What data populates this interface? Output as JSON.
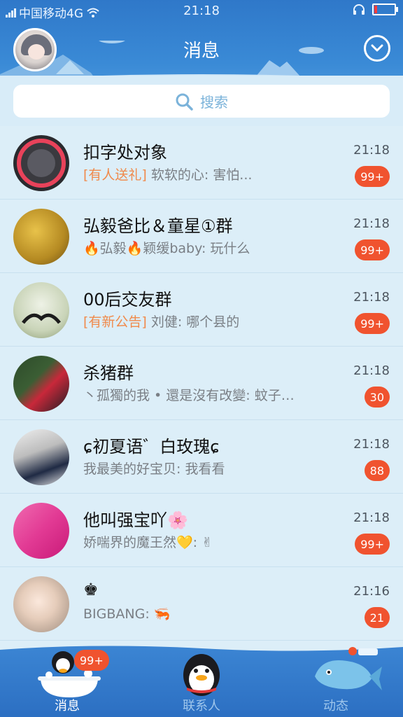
{
  "status_bar": {
    "carrier": "中国移动4G",
    "time": "21:18"
  },
  "header": {
    "title": "消息"
  },
  "search": {
    "placeholder": "搜索"
  },
  "conversations": [
    {
      "name": "扣字处对象",
      "tag": "[有人送礼]",
      "message": " 软软的心: 害怕...",
      "time": "21:18",
      "badge": "99+"
    },
    {
      "name": "弘毅爸比＆童星①群",
      "tag": "",
      "message": "🔥弘毅🔥颖缓baby: 玩什么",
      "time": "21:18",
      "badge": "99+"
    },
    {
      "name": "00后交友群",
      "tag": "[有新公告]",
      "message": " 刘健: 哪个县的",
      "time": "21:18",
      "badge": "99+"
    },
    {
      "name": "杀猪群",
      "tag": "",
      "message": "丶孤獨的我 • 還是沒有改變: 蚊子…",
      "time": "21:18",
      "badge": "30"
    },
    {
      "name": "ɕ初夏语゛白玫瑰ɕ",
      "tag": "",
      "message": "我最美的好宝贝: 我看看",
      "time": "21:18",
      "badge": "88"
    },
    {
      "name": "他叫强宝吖🌸",
      "tag": "",
      "message": "娇喘界的魔王然💛: ✌",
      "time": "21:18",
      "badge": "99+"
    },
    {
      "name": "♚",
      "tag": "",
      "message": "BIGBANG: 🦐",
      "time": "21:16",
      "badge": "21"
    }
  ],
  "tabbar": {
    "tabs": [
      {
        "label": "消息",
        "badge": "99+",
        "active": true
      },
      {
        "label": "联系人",
        "badge": "",
        "active": false
      },
      {
        "label": "动态",
        "badge": "",
        "active": false
      }
    ]
  },
  "colors": {
    "header_blue": "#3a8ad6",
    "badge_red": "#f0532f",
    "tag_orange": "#f08a4b",
    "list_bg": "#dceef8"
  }
}
